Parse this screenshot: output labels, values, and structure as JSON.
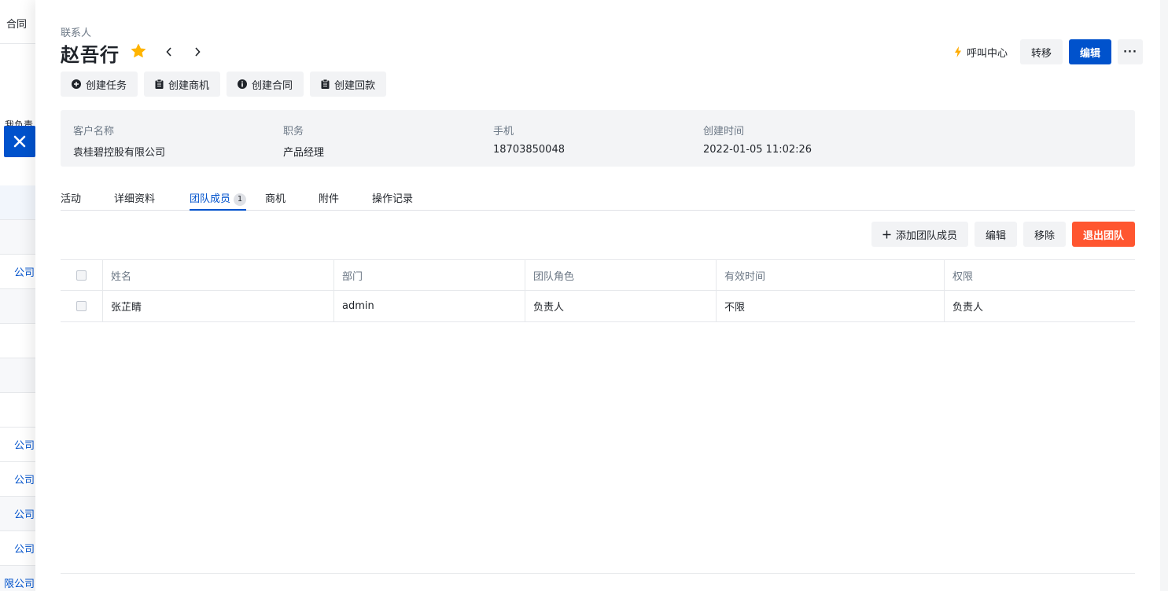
{
  "background": {
    "header_label": "合同",
    "mine_label": "我负责",
    "rows": [
      "",
      "",
      "公司",
      "",
      "",
      "",
      "",
      "公司",
      "公司",
      "公司",
      "公司",
      "限公司"
    ]
  },
  "drawer": {
    "breadcrumb": "联系人",
    "title": "赵吾行",
    "call_center_label": "呼叫中心",
    "transfer_label": "转移",
    "edit_label": "编辑",
    "more_label": "···",
    "quick_actions": [
      {
        "label": "创建任务",
        "icon": "plus-circle-icon"
      },
      {
        "label": "创建商机",
        "icon": "clipboard-icon"
      },
      {
        "label": "创建合同",
        "icon": "info-icon"
      },
      {
        "label": "创建回款",
        "icon": "clipboard-icon"
      }
    ],
    "info": [
      {
        "label": "客户名称",
        "value": "袁桂碧控股有限公司"
      },
      {
        "label": "职务",
        "value": "产品经理"
      },
      {
        "label": "手机",
        "value": "18703850048"
      },
      {
        "label": "创建时间",
        "value": "2022-01-05 11:02:26"
      }
    ],
    "tabs": [
      {
        "label": "活动"
      },
      {
        "label": "详细资料"
      },
      {
        "label": "团队成员",
        "badge": "1",
        "active": true
      },
      {
        "label": "商机"
      },
      {
        "label": "附件"
      },
      {
        "label": "操作记录"
      }
    ],
    "table_actions": {
      "add_member": "添加团队成员",
      "edit": "编辑",
      "remove": "移除",
      "exit_team": "退出团队"
    },
    "table": {
      "columns": [
        "姓名",
        "部门",
        "团队角色",
        "有效时间",
        "权限"
      ],
      "rows": [
        [
          "张芷睛",
          "admin",
          "负责人",
          "不限",
          "负责人"
        ]
      ]
    },
    "colors": {
      "primary": "#0052cc",
      "danger": "#ff5630",
      "star": "#ffb400"
    }
  }
}
